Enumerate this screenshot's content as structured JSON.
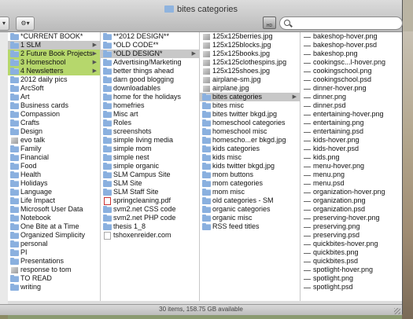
{
  "window": {
    "title": "bites categories"
  },
  "toolbar": {
    "action_label": "⚙▾"
  },
  "search": {
    "placeholder": "",
    "value": ""
  },
  "status": {
    "text": "30 items, 158.75 GB available"
  },
  "columns": [
    {
      "items": [
        {
          "icon": "folder",
          "label": "*CURRENT BOOK*",
          "state": ""
        },
        {
          "icon": "folder",
          "label": "1 SLM",
          "state": "sel",
          "arrow": true
        },
        {
          "icon": "folder",
          "label": "2 Future Book Projects",
          "state": "green",
          "arrow": true
        },
        {
          "icon": "folder",
          "label": "3 Homeschool",
          "state": "green",
          "arrow": true
        },
        {
          "icon": "folder",
          "label": "4 Newsletters",
          "state": "green",
          "arrow": true
        },
        {
          "icon": "folder",
          "label": "2012 daily pics",
          "state": ""
        },
        {
          "icon": "folder",
          "label": "ArcSoft",
          "state": ""
        },
        {
          "icon": "folder",
          "label": "Art",
          "state": ""
        },
        {
          "icon": "folder",
          "label": "Business cards",
          "state": ""
        },
        {
          "icon": "folder",
          "label": "Compassion",
          "state": ""
        },
        {
          "icon": "folder",
          "label": "Crafts",
          "state": ""
        },
        {
          "icon": "folder",
          "label": "Design",
          "state": ""
        },
        {
          "icon": "img",
          "label": "evo talk",
          "state": ""
        },
        {
          "icon": "folder",
          "label": "Family",
          "state": ""
        },
        {
          "icon": "folder",
          "label": "Financial",
          "state": ""
        },
        {
          "icon": "folder",
          "label": "Food",
          "state": ""
        },
        {
          "icon": "folder",
          "label": "Health",
          "state": ""
        },
        {
          "icon": "folder",
          "label": "Holidays",
          "state": ""
        },
        {
          "icon": "folder",
          "label": "Language",
          "state": ""
        },
        {
          "icon": "folder",
          "label": "Life Impact",
          "state": ""
        },
        {
          "icon": "folder",
          "label": "Microsoft User Data",
          "state": ""
        },
        {
          "icon": "folder",
          "label": "Notebook",
          "state": ""
        },
        {
          "icon": "folder",
          "label": "One Bite at a Time",
          "state": ""
        },
        {
          "icon": "folder",
          "label": "Organized Simplicity",
          "state": ""
        },
        {
          "icon": "folder",
          "label": "personal",
          "state": ""
        },
        {
          "icon": "folder",
          "label": "PI",
          "state": ""
        },
        {
          "icon": "folder",
          "label": "Presentations",
          "state": ""
        },
        {
          "icon": "img",
          "label": "response to tom",
          "state": ""
        },
        {
          "icon": "folder",
          "label": "TO READ",
          "state": ""
        },
        {
          "icon": "folder",
          "label": "writing",
          "state": ""
        }
      ]
    },
    {
      "items": [
        {
          "icon": "folder",
          "label": "**2012 DESIGN**",
          "state": ""
        },
        {
          "icon": "folder",
          "label": "*OLD CODE**",
          "state": ""
        },
        {
          "icon": "folder",
          "label": "*OLD DESIGN*",
          "state": "sel",
          "arrow": true
        },
        {
          "icon": "folder",
          "label": "Advertising/Marketing",
          "state": ""
        },
        {
          "icon": "folder",
          "label": "better things ahead",
          "state": ""
        },
        {
          "icon": "folder",
          "label": "darn good blogging",
          "state": ""
        },
        {
          "icon": "folder",
          "label": "downloadables",
          "state": ""
        },
        {
          "icon": "folder",
          "label": "home for the holidays",
          "state": ""
        },
        {
          "icon": "folder",
          "label": "homefries",
          "state": ""
        },
        {
          "icon": "folder",
          "label": "Misc art",
          "state": ""
        },
        {
          "icon": "folder",
          "label": "Roles",
          "state": ""
        },
        {
          "icon": "folder",
          "label": "screenshots",
          "state": ""
        },
        {
          "icon": "folder",
          "label": "simple living media",
          "state": ""
        },
        {
          "icon": "folder",
          "label": "simple mom",
          "state": ""
        },
        {
          "icon": "folder",
          "label": "simple nest",
          "state": ""
        },
        {
          "icon": "folder",
          "label": "simple organic",
          "state": ""
        },
        {
          "icon": "folder",
          "label": "SLM Campus Site",
          "state": ""
        },
        {
          "icon": "folder",
          "label": "SLM Site",
          "state": ""
        },
        {
          "icon": "folder",
          "label": "SLM Staff Site",
          "state": ""
        },
        {
          "icon": "pdf",
          "label": "springcleaning.pdf",
          "state": ""
        },
        {
          "icon": "folder",
          "label": "svm2.net CSS code",
          "state": ""
        },
        {
          "icon": "folder",
          "label": "svm2.net PHP code",
          "state": ""
        },
        {
          "icon": "folder",
          "label": "thesis 1_8",
          "state": ""
        },
        {
          "icon": "file",
          "label": "tshoxenreider.com",
          "state": ""
        }
      ]
    },
    {
      "items": [
        {
          "icon": "img",
          "label": "125x125berries.jpg",
          "state": ""
        },
        {
          "icon": "img",
          "label": "125x125blocks.jpg",
          "state": ""
        },
        {
          "icon": "img",
          "label": "125x125books.jpg",
          "state": ""
        },
        {
          "icon": "img",
          "label": "125x125clothespins.jpg",
          "state": ""
        },
        {
          "icon": "img",
          "label": "125x125shoes.jpg",
          "state": ""
        },
        {
          "icon": "img",
          "label": "airplane-sm.jpg",
          "state": ""
        },
        {
          "icon": "img",
          "label": "airplane.jpg",
          "state": ""
        },
        {
          "icon": "folder",
          "label": "bites categories",
          "state": "sel",
          "arrow": true
        },
        {
          "icon": "folder",
          "label": "bites misc",
          "state": ""
        },
        {
          "icon": "folder",
          "label": "bites twitter bkgd.jpg",
          "state": ""
        },
        {
          "icon": "folder",
          "label": "homeschool categories",
          "state": ""
        },
        {
          "icon": "folder",
          "label": "homeschool misc",
          "state": ""
        },
        {
          "icon": "folder",
          "label": "homescho...er bkgd.jpg",
          "state": ""
        },
        {
          "icon": "folder",
          "label": "kids categories",
          "state": ""
        },
        {
          "icon": "folder",
          "label": "kids misc",
          "state": ""
        },
        {
          "icon": "folder",
          "label": "kids twitter bkgd.jpg",
          "state": ""
        },
        {
          "icon": "folder",
          "label": "mom buttons",
          "state": ""
        },
        {
          "icon": "folder",
          "label": "mom categories",
          "state": ""
        },
        {
          "icon": "folder",
          "label": "mom misc",
          "state": ""
        },
        {
          "icon": "folder",
          "label": "old categories - SM",
          "state": ""
        },
        {
          "icon": "folder",
          "label": "organic categories",
          "state": ""
        },
        {
          "icon": "folder",
          "label": "organic misc",
          "state": ""
        },
        {
          "icon": "folder",
          "label": "RSS feed titles",
          "state": ""
        }
      ]
    },
    {
      "items": [
        {
          "icon": "dash",
          "label": "bakeshop-hover.png",
          "state": ""
        },
        {
          "icon": "dash",
          "label": "bakeshop-hover.psd",
          "state": ""
        },
        {
          "icon": "dash",
          "label": "bakeshop.png",
          "state": ""
        },
        {
          "icon": "dash",
          "label": "cookingsc...l-hover.png",
          "state": ""
        },
        {
          "icon": "dash",
          "label": "cookingschool.png",
          "state": ""
        },
        {
          "icon": "dash",
          "label": "cookingschool.psd",
          "state": ""
        },
        {
          "icon": "dash",
          "label": "dinner-hover.png",
          "state": ""
        },
        {
          "icon": "dash",
          "label": "dinner.png",
          "state": ""
        },
        {
          "icon": "dash",
          "label": "dinner.psd",
          "state": ""
        },
        {
          "icon": "dash",
          "label": "entertaining-hover.png",
          "state": ""
        },
        {
          "icon": "dash",
          "label": "entertaining.png",
          "state": ""
        },
        {
          "icon": "dash",
          "label": "entertaining.psd",
          "state": ""
        },
        {
          "icon": "dash",
          "label": "kids-hover.png",
          "state": ""
        },
        {
          "icon": "dash",
          "label": "kids-hover.psd",
          "state": ""
        },
        {
          "icon": "dash",
          "label": "kids.png",
          "state": ""
        },
        {
          "icon": "dash",
          "label": "menu-hover.png",
          "state": ""
        },
        {
          "icon": "dash",
          "label": "menu.png",
          "state": ""
        },
        {
          "icon": "dash",
          "label": "menu.psd",
          "state": ""
        },
        {
          "icon": "dash",
          "label": "organization-hover.png",
          "state": ""
        },
        {
          "icon": "dash",
          "label": "organization.png",
          "state": ""
        },
        {
          "icon": "dash",
          "label": "organization.psd",
          "state": ""
        },
        {
          "icon": "dash",
          "label": "preserving-hover.png",
          "state": ""
        },
        {
          "icon": "dash",
          "label": "preserving.png",
          "state": ""
        },
        {
          "icon": "dash",
          "label": "preserving.psd",
          "state": ""
        },
        {
          "icon": "dash",
          "label": "quickbites-hover.png",
          "state": ""
        },
        {
          "icon": "dash",
          "label": "quickbites.png",
          "state": ""
        },
        {
          "icon": "dash",
          "label": "quickbites.psd",
          "state": ""
        },
        {
          "icon": "dash",
          "label": "spotlight-hover.png",
          "state": ""
        },
        {
          "icon": "dash",
          "label": "spotlight.png",
          "state": ""
        },
        {
          "icon": "dash",
          "label": "spotlight.psd",
          "state": ""
        }
      ]
    }
  ]
}
